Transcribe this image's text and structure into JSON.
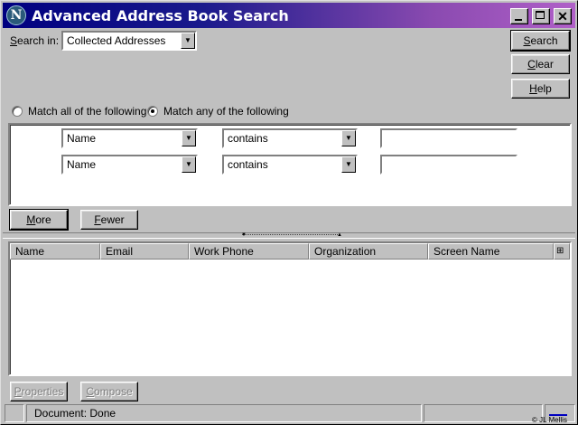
{
  "window": {
    "title": "Advanced Address Book Search",
    "logo_letter": "N",
    "controls": [
      "minimize-icon",
      "maximize-icon",
      "close-icon"
    ]
  },
  "search_in": {
    "label_prefix": "S",
    "label_rest": "earch in:",
    "value": "Collected Addresses"
  },
  "buttons": {
    "search_u": "S",
    "search_rest": "earch",
    "clear_u": "C",
    "clear_rest": "lear",
    "help_u": "H",
    "help_rest": "elp",
    "more_u": "M",
    "more_rest": "ore",
    "fewer_u": "F",
    "fewer_rest": "ewer",
    "properties_u": "P",
    "properties_rest": "roperties",
    "compose_u": "C",
    "compose_rest": "ompose"
  },
  "match": {
    "all_label": "Match all of the following",
    "any_label": "Match any of the following",
    "selected": "any"
  },
  "criteria": [
    {
      "field": "Name",
      "operator": "contains",
      "value": ""
    },
    {
      "field": "Name",
      "operator": "contains",
      "value": ""
    }
  ],
  "results": {
    "columns": [
      "Name",
      "Email",
      "Work Phone",
      "Organization",
      "Screen Name"
    ],
    "rows": []
  },
  "status": {
    "text": "Document: Done",
    "watermark": "© JL Mellis"
  },
  "colors": {
    "title_gradient_start": "#000080",
    "title_gradient_end": "#b060c8",
    "face": "#c0c0c0"
  }
}
